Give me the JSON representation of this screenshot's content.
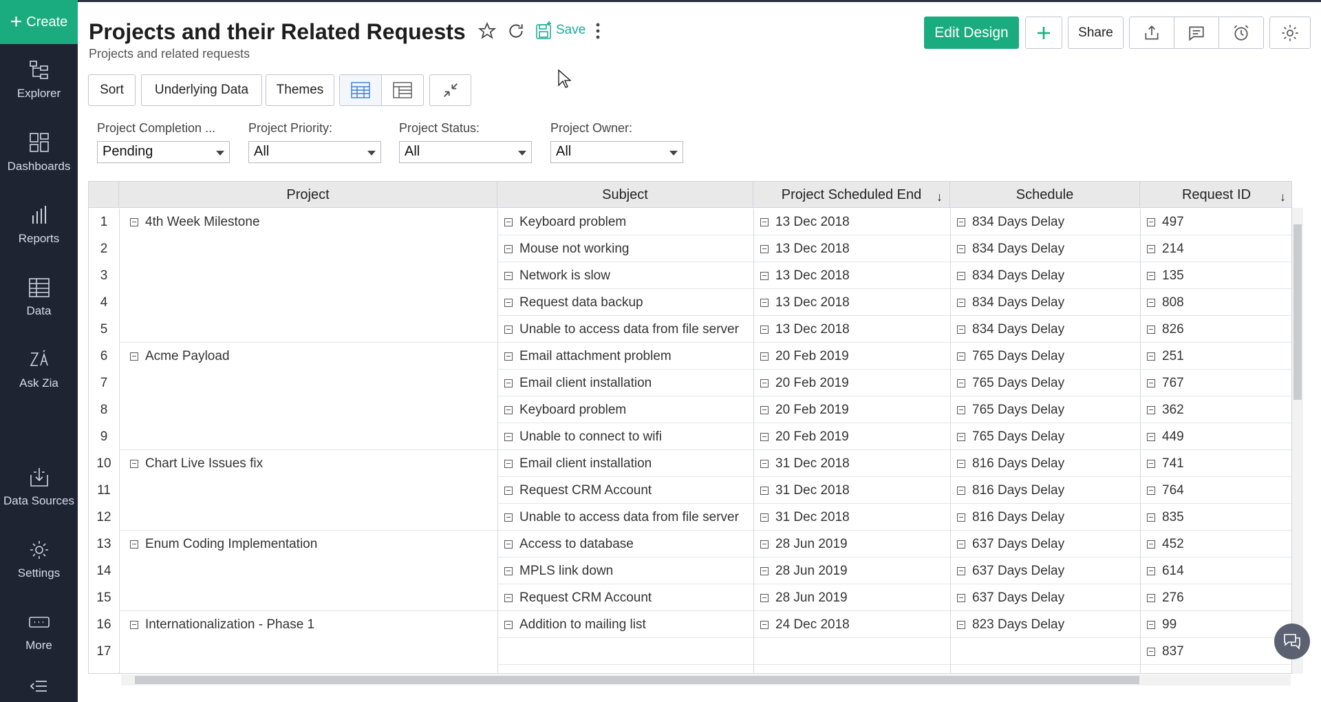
{
  "sidebar": {
    "create_label": "Create",
    "items": [
      {
        "label": "Explorer",
        "icon": "explorer-icon"
      },
      {
        "label": "Dashboards",
        "icon": "dashboards-icon"
      },
      {
        "label": "Reports",
        "icon": "reports-icon"
      },
      {
        "label": "Data",
        "icon": "data-icon"
      },
      {
        "label": "Ask Zia",
        "icon": "ask-zia-icon"
      },
      {
        "label": "Data Sources",
        "icon": "data-sources-icon"
      },
      {
        "label": "Settings",
        "icon": "settings-icon"
      },
      {
        "label": "More",
        "icon": "more-icon"
      }
    ]
  },
  "header": {
    "title": "Projects and their Related Requests",
    "subtitle": "Projects and related requests",
    "save_label": "Save",
    "edit_design_label": "Edit Design",
    "share_label": "Share"
  },
  "toolbar": {
    "sort_label": "Sort",
    "underlying_data_label": "Underlying Data",
    "themes_label": "Themes"
  },
  "filters": [
    {
      "label": "Project Completion ...",
      "value": "Pending"
    },
    {
      "label": "Project Priority:",
      "value": "All"
    },
    {
      "label": "Project Status:",
      "value": "All"
    },
    {
      "label": "Project Owner:",
      "value": "All"
    }
  ],
  "table": {
    "columns": [
      "Project",
      "Subject",
      "Project Scheduled End",
      "Schedule",
      "Request ID"
    ],
    "rows": [
      {
        "n": "1",
        "project": "4th Week Milestone",
        "subject": "Keyboard problem",
        "end": "13 Dec 2018",
        "schedule": "834 Days Delay",
        "id": "497"
      },
      {
        "n": "2",
        "project": "",
        "subject": "Mouse not working",
        "end": "13 Dec 2018",
        "schedule": "834 Days Delay",
        "id": "214"
      },
      {
        "n": "3",
        "project": "",
        "subject": "Network is slow",
        "end": "13 Dec 2018",
        "schedule": "834 Days Delay",
        "id": "135"
      },
      {
        "n": "4",
        "project": "",
        "subject": "Request data backup",
        "end": "13 Dec 2018",
        "schedule": "834 Days Delay",
        "id": "808"
      },
      {
        "n": "5",
        "project": "",
        "subject": "Unable to access data from file server",
        "end": "13 Dec 2018",
        "schedule": "834 Days Delay",
        "id": "826"
      },
      {
        "n": "6",
        "project": "Acme Payload",
        "subject": "Email attachment problem",
        "end": "20 Feb 2019",
        "schedule": "765 Days Delay",
        "id": "251"
      },
      {
        "n": "7",
        "project": "",
        "subject": "Email client installation",
        "end": "20 Feb 2019",
        "schedule": "765 Days Delay",
        "id": "767"
      },
      {
        "n": "8",
        "project": "",
        "subject": "Keyboard problem",
        "end": "20 Feb 2019",
        "schedule": "765 Days Delay",
        "id": "362"
      },
      {
        "n": "9",
        "project": "",
        "subject": "Unable to connect to wifi",
        "end": "20 Feb 2019",
        "schedule": "765 Days Delay",
        "id": "449"
      },
      {
        "n": "10",
        "project": "Chart Live Issues fix",
        "subject": "Email client installation",
        "end": "31 Dec 2018",
        "schedule": "816 Days Delay",
        "id": "741"
      },
      {
        "n": "11",
        "project": "",
        "subject": "Request CRM Account",
        "end": "31 Dec 2018",
        "schedule": "816 Days Delay",
        "id": "764"
      },
      {
        "n": "12",
        "project": "",
        "subject": "Unable to access data from file server",
        "end": "31 Dec 2018",
        "schedule": "816 Days Delay",
        "id": "835"
      },
      {
        "n": "13",
        "project": "Enum Coding Implementation",
        "subject": "Access to database",
        "end": "28 Jun 2019",
        "schedule": "637 Days Delay",
        "id": "452"
      },
      {
        "n": "14",
        "project": "",
        "subject": "MPLS link down",
        "end": "28 Jun 2019",
        "schedule": "637 Days Delay",
        "id": "614"
      },
      {
        "n": "15",
        "project": "",
        "subject": "Request CRM Account",
        "end": "28 Jun 2019",
        "schedule": "637 Days Delay",
        "id": "276"
      },
      {
        "n": "16",
        "project": "Internationalization - Phase 1",
        "subject": "Addition to mailing list",
        "end": "24 Dec 2018",
        "schedule": "823 Days Delay",
        "id": "99"
      },
      {
        "n": "17",
        "project": "",
        "subject": "",
        "end": "",
        "schedule": "",
        "id": "837"
      }
    ]
  }
}
